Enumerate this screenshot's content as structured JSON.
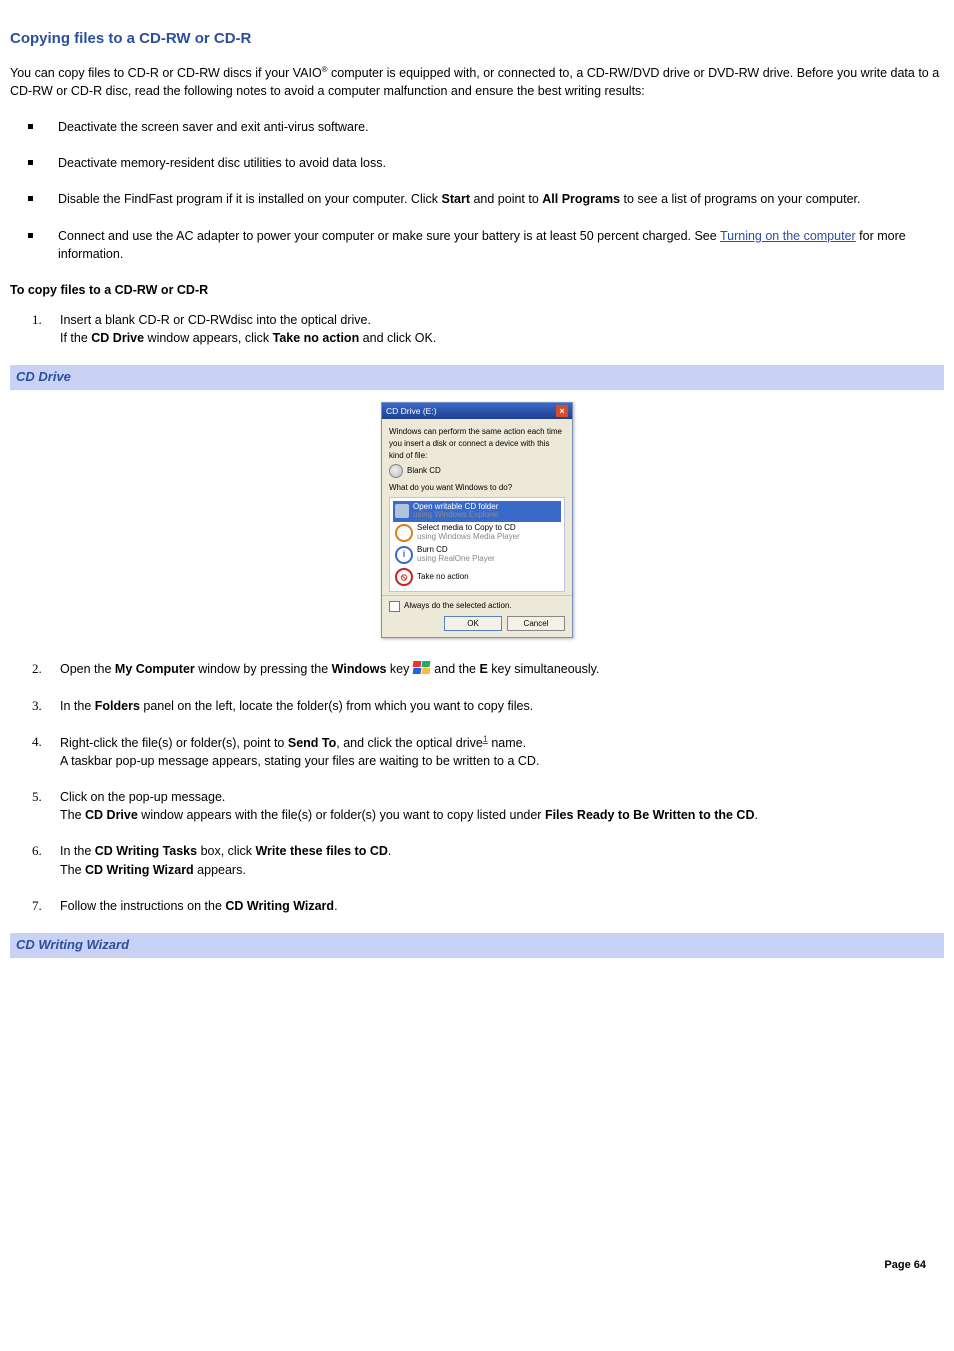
{
  "title": "Copying files to a CD-RW or CD-R",
  "intro_a": "You can copy files to CD-R or CD-RW discs if your VAIO",
  "intro_reg": "®",
  "intro_b": " computer is equipped with, or connected to, a CD-RW/DVD drive or DVD-RW drive. Before you write data to a CD-RW or CD-R disc, read the following notes to avoid a computer malfunction and ensure the best writing results:",
  "notes": {
    "n1": "Deactivate the screen saver and exit anti-virus software.",
    "n2": "Deactivate memory-resident disc utilities to avoid data loss.",
    "n3_a": "Disable the FindFast program if it is installed on your computer. Click ",
    "n3_b": "Start",
    "n3_c": " and point to ",
    "n3_d": "All Programs",
    "n3_e": " to see a list of programs on your computer.",
    "n4_a": "Connect and use the AC adapter to power your computer or make sure your battery is at least 50 percent charged. See ",
    "n4_link": "Turning on the computer",
    "n4_b": " for more information."
  },
  "subhead": "To copy files to a CD-RW or CD-R",
  "steps": {
    "s1a": "Insert a blank CD-R or CD-RWdisc into the optical drive.",
    "s1b_a": "If the ",
    "s1b_b": "CD Drive",
    "s1b_c": " window appears, click ",
    "s1b_d": "Take no action",
    "s1b_e": " and click OK.",
    "s2_a": "Open the ",
    "s2_b": "My Computer",
    "s2_c": " window by pressing the ",
    "s2_d": "Windows",
    "s2_e": " key ",
    "s2_f": " and the ",
    "s2_g": "E",
    "s2_h": " key simultaneously.",
    "s3_a": "In the ",
    "s3_b": "Folders",
    "s3_c": " panel on the left, locate the folder(s) from which you want to copy files.",
    "s4_a": "Right-click the file(s) or folder(s), point to ",
    "s4_b": "Send To",
    "s4_c": ", and click the optical drive",
    "s4_fn": "1",
    "s4_d": " name.",
    "s4_e": "A taskbar pop-up message appears, stating your files are waiting to be written to a CD.",
    "s5_a": "Click on the pop-up message.",
    "s5_b": "The ",
    "s5_c": "CD Drive",
    "s5_d": " window appears with the file(s) or folder(s) you want to copy listed under ",
    "s5_e": "Files Ready to Be Written to the CD",
    "s5_f": ".",
    "s6_a": "In the ",
    "s6_b": "CD Writing Tasks",
    "s6_c": " box, click ",
    "s6_d": "Write these files to CD",
    "s6_e": ".",
    "s6_f": "The ",
    "s6_g": "CD Writing Wizard",
    "s6_h": " appears.",
    "s7_a": "Follow the instructions on the ",
    "s7_b": "CD Writing Wizard",
    "s7_c": "."
  },
  "caption1": "CD Drive",
  "caption2": "CD Writing Wizard",
  "dialog": {
    "title": "CD Drive (E:)",
    "line1": "Windows can perform the same action each time you insert a disk or connect a device with this kind of file:",
    "disc": "Blank CD",
    "line2": "What do you want Windows to do?",
    "opt1a": "Open writable CD folder",
    "opt1b": "using Windows Explorer",
    "opt2a": "Select media to Copy to CD",
    "opt2b": "using Windows Media Player",
    "opt3a": "Burn CD",
    "opt3b": "using RealOne Player",
    "opt4": "Take no action",
    "always": "Always do the selected action.",
    "ok": "OK",
    "cancel": "Cancel"
  },
  "footer": "Page 64"
}
